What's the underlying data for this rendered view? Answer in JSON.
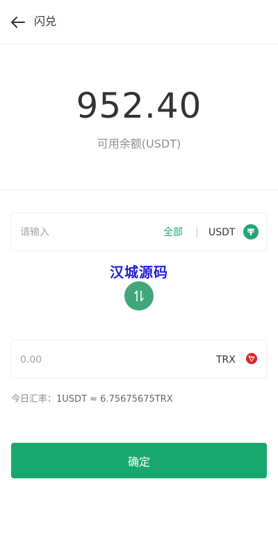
{
  "header": {
    "back_icon": "arrow-left-icon",
    "title": "闪兑"
  },
  "balance": {
    "amount": "952.40",
    "label": "可用余额(USDT)"
  },
  "from_field": {
    "placeholder": "请输入",
    "value": "",
    "all_label": "全部",
    "separator": "|",
    "coin": "USDT",
    "coin_icon": "tether-icon",
    "coin_color": "#26a17b"
  },
  "watermark": "汉城源码",
  "swap_icon": "swap-vertical-icon",
  "to_field": {
    "value": "0.00",
    "coin": "TRX",
    "coin_icon": "tron-icon",
    "coin_color": "#e0232b"
  },
  "rate": {
    "label": "今日汇率：",
    "value": "1USDT ≈ 6.75675675TRX"
  },
  "confirm": {
    "label": "确定",
    "color": "#18a86e"
  },
  "colors": {
    "accent": "#1aa86b",
    "swap_button": "#3fa779"
  }
}
